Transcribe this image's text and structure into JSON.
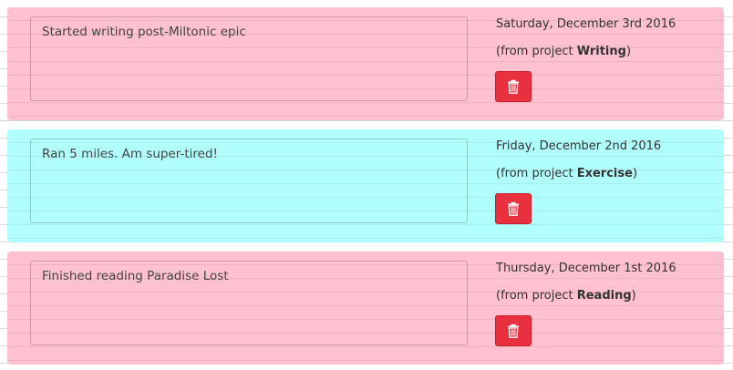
{
  "entries": [
    {
      "text": "Started writing post-Miltonic epic",
      "date": "Saturday, December 3rd 2016",
      "project_prefix": "(from project ",
      "project": "Writing",
      "project_suffix": ")",
      "bg_color": "#ffc0cf"
    },
    {
      "text": "Ran 5 miles. Am super-tired!",
      "date": "Friday, December 2nd 2016",
      "project_prefix": "(from project ",
      "project": "Exercise",
      "project_suffix": ")",
      "bg_color": "#b0fffc"
    },
    {
      "text": "Finished reading Paradise Lost",
      "date": "Thursday, December 1st 2016",
      "project_prefix": "(from project ",
      "project": "Reading",
      "project_suffix": ")",
      "bg_color": "#ffc0cf"
    }
  ],
  "delete_icon": "trash-icon",
  "delete_color": "#e8303f"
}
